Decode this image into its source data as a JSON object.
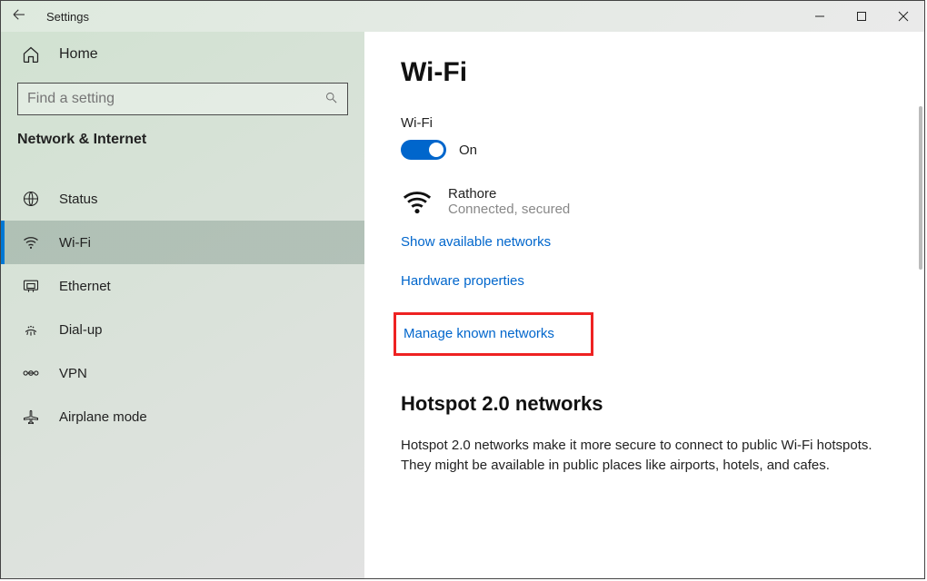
{
  "titlebar": {
    "title": "Settings"
  },
  "sidebar": {
    "home_label": "Home",
    "search_placeholder": "Find a setting",
    "category": "Network & Internet",
    "items": [
      {
        "label": "Status"
      },
      {
        "label": "Wi-Fi"
      },
      {
        "label": "Ethernet"
      },
      {
        "label": "Dial-up"
      },
      {
        "label": "VPN"
      },
      {
        "label": "Airplane mode"
      }
    ]
  },
  "main": {
    "title": "Wi-Fi",
    "wifi_label": "Wi-Fi",
    "toggle_state": "On",
    "connected_name": "Rathore",
    "connected_status": "Connected, secured",
    "link_show_available": "Show available networks",
    "link_hardware_props": "Hardware properties",
    "link_manage_known": "Manage known networks",
    "hotspot_heading": "Hotspot 2.0 networks",
    "hotspot_body": "Hotspot 2.0 networks make it more secure to connect to public Wi-Fi hotspots. They might be available in public places like airports, hotels, and cafes."
  }
}
